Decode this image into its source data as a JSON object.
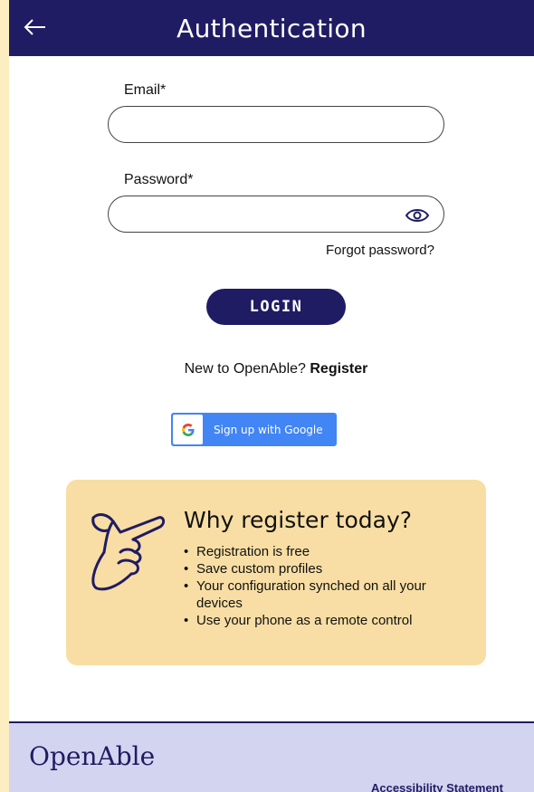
{
  "header": {
    "title": "Authentication",
    "back_icon": "arrow-left-icon"
  },
  "form": {
    "email_label": "Email*",
    "email_value": "",
    "password_label": "Password*",
    "password_value": "",
    "eye_icon": "eye-icon",
    "forgot_password": "Forgot password?",
    "login_button": "LOGIN"
  },
  "register_prompt": {
    "text": "New to OpenAble? ",
    "link": "Register"
  },
  "google": {
    "label": "Sign up with Google",
    "icon": "google-g-icon"
  },
  "promo": {
    "title": "Why register today?",
    "icon": "pointing-hand-icon",
    "items": [
      "Registration is free",
      "Save custom profiles",
      "Your configuration synched on all your devices",
      "Use your phone as a remote control"
    ]
  },
  "footer": {
    "brand": "OpenAble",
    "accessibility_link": "Accessibility Statement"
  },
  "colors": {
    "primary": "#201c63",
    "promo_bg": "#f8dea4",
    "footer_bg": "#d3d4f0",
    "google_blue": "#4285f4"
  }
}
